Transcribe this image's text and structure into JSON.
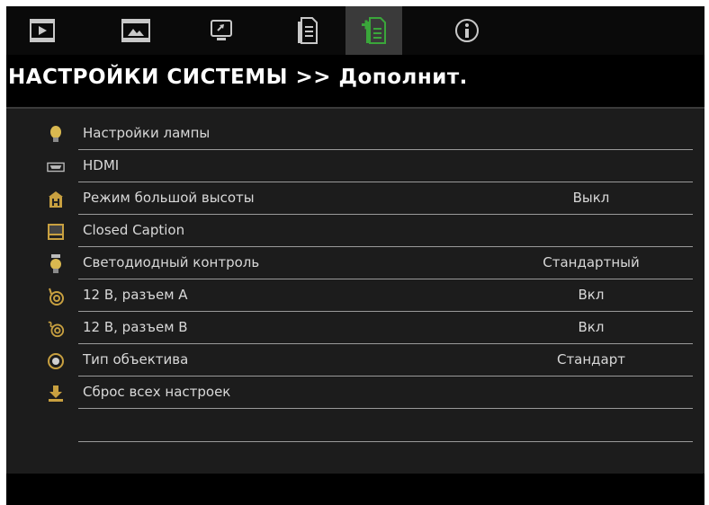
{
  "header": {
    "title": "НАСТРОЙКИ СИСТЕМЫ >> Дополнит."
  },
  "tabs": [
    {
      "icon": "film-play-icon",
      "active": false
    },
    {
      "icon": "film-image-icon",
      "active": false
    },
    {
      "icon": "monitor-icon",
      "active": false
    },
    {
      "icon": "document-icon",
      "active": false
    },
    {
      "icon": "document-plus-icon",
      "active": true
    },
    {
      "icon": "info-icon",
      "active": false
    }
  ],
  "menu": {
    "items": [
      {
        "label": "Настройки лампы",
        "value": "",
        "icon": "lamp-icon"
      },
      {
        "label": "HDMI",
        "value": "",
        "icon": "hdmi-icon"
      },
      {
        "label": "Режим большой высоты",
        "value": "Выкл",
        "icon": "high-altitude-icon"
      },
      {
        "label": "Closed Caption",
        "value": "",
        "icon": "closed-caption-icon"
      },
      {
        "label": "Светодиодный контроль",
        "value": "Стандартный",
        "icon": "led-icon"
      },
      {
        "label": "12 В, разъем А",
        "value": "Вкл",
        "icon": "trigger-a-icon"
      },
      {
        "label": "12 В, разъем В",
        "value": "Вкл",
        "icon": "trigger-b-icon"
      },
      {
        "label": "Тип объектива",
        "value": "Стандарт",
        "icon": "lens-icon"
      },
      {
        "label": "Сброс всех настроек",
        "value": "",
        "icon": "reset-icon"
      }
    ]
  },
  "colors": {
    "tab_active_icon": "#3aa63a",
    "icon_gold": "#c8a040",
    "panel_bg": "#1c1c1c",
    "text": "#d8d8d8"
  }
}
